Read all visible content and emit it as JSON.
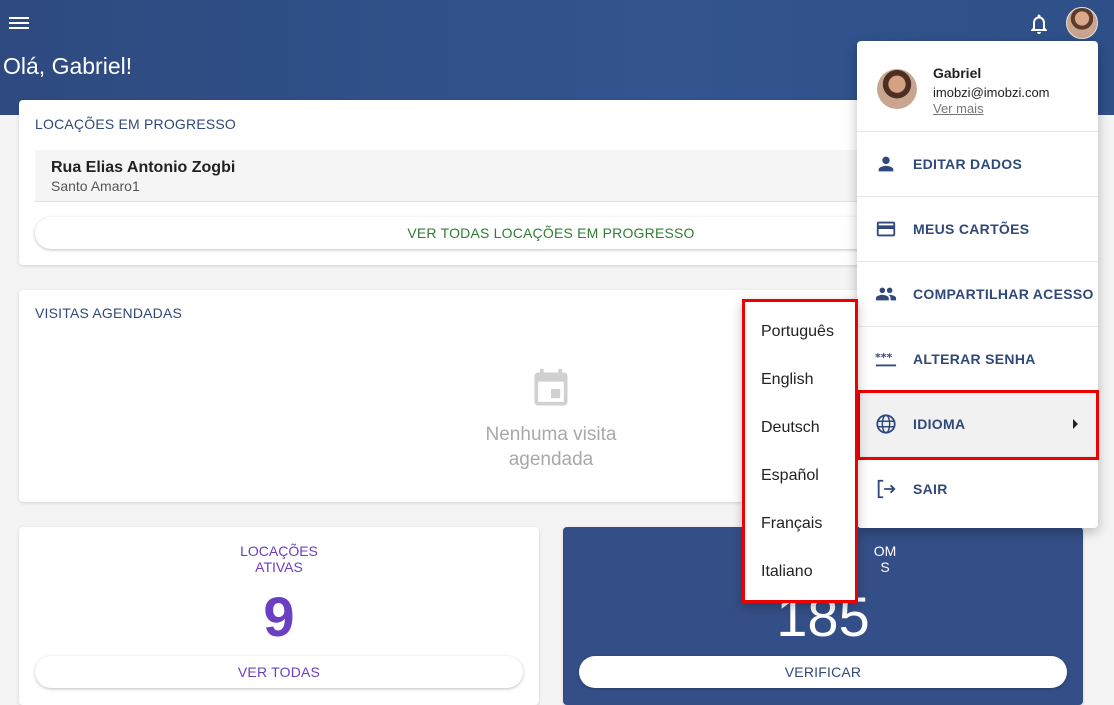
{
  "header": {
    "greeting": "Olá, Gabriel!"
  },
  "progress_card": {
    "title": "LOCAÇÕES EM PROGRESSO",
    "items": [
      {
        "street": "Rua Elias Antonio Zogbi",
        "area": "Santo Amaro1"
      }
    ],
    "button_label": "VER TODAS LOCAÇÕES EM PROGRESSO"
  },
  "visits_card": {
    "title": "VISITAS AGENDADAS",
    "empty_line1": "Nenhuma visita",
    "empty_line2": "agendada"
  },
  "active_card": {
    "label_line1": "LOCAÇÕES",
    "label_line2": "ATIVAS",
    "value": "9",
    "button_label": "VER TODAS"
  },
  "second_stat_card": {
    "label_line1": "OM",
    "label_line2": "S",
    "value": "185",
    "button_label": "VERIFICAR"
  },
  "user_menu": {
    "name": "Gabriel",
    "email": "imobzi@imobzi.com",
    "more_link": "Ver mais",
    "items": [
      {
        "label": "EDITAR DADOS",
        "icon": "person-icon"
      },
      {
        "label": "MEUS CARTÕES",
        "icon": "credit-card-icon"
      },
      {
        "label": "COMPARTILHAR ACESSO",
        "icon": "people-icon"
      },
      {
        "label": "ALTERAR SENHA",
        "icon": "password-icon"
      },
      {
        "label": "IDIOMA",
        "icon": "globe-icon"
      },
      {
        "label": "SAIR",
        "icon": "logout-icon"
      }
    ]
  },
  "language_menu": {
    "options": [
      "Português",
      "English",
      "Deutsch",
      "Español",
      "Français",
      "Italiano"
    ]
  },
  "colors": {
    "header_blue": "#2e4a80",
    "accent_purple": "#6a3fc2",
    "accent_green": "#2e7d32",
    "highlight_red": "#ee0000"
  }
}
